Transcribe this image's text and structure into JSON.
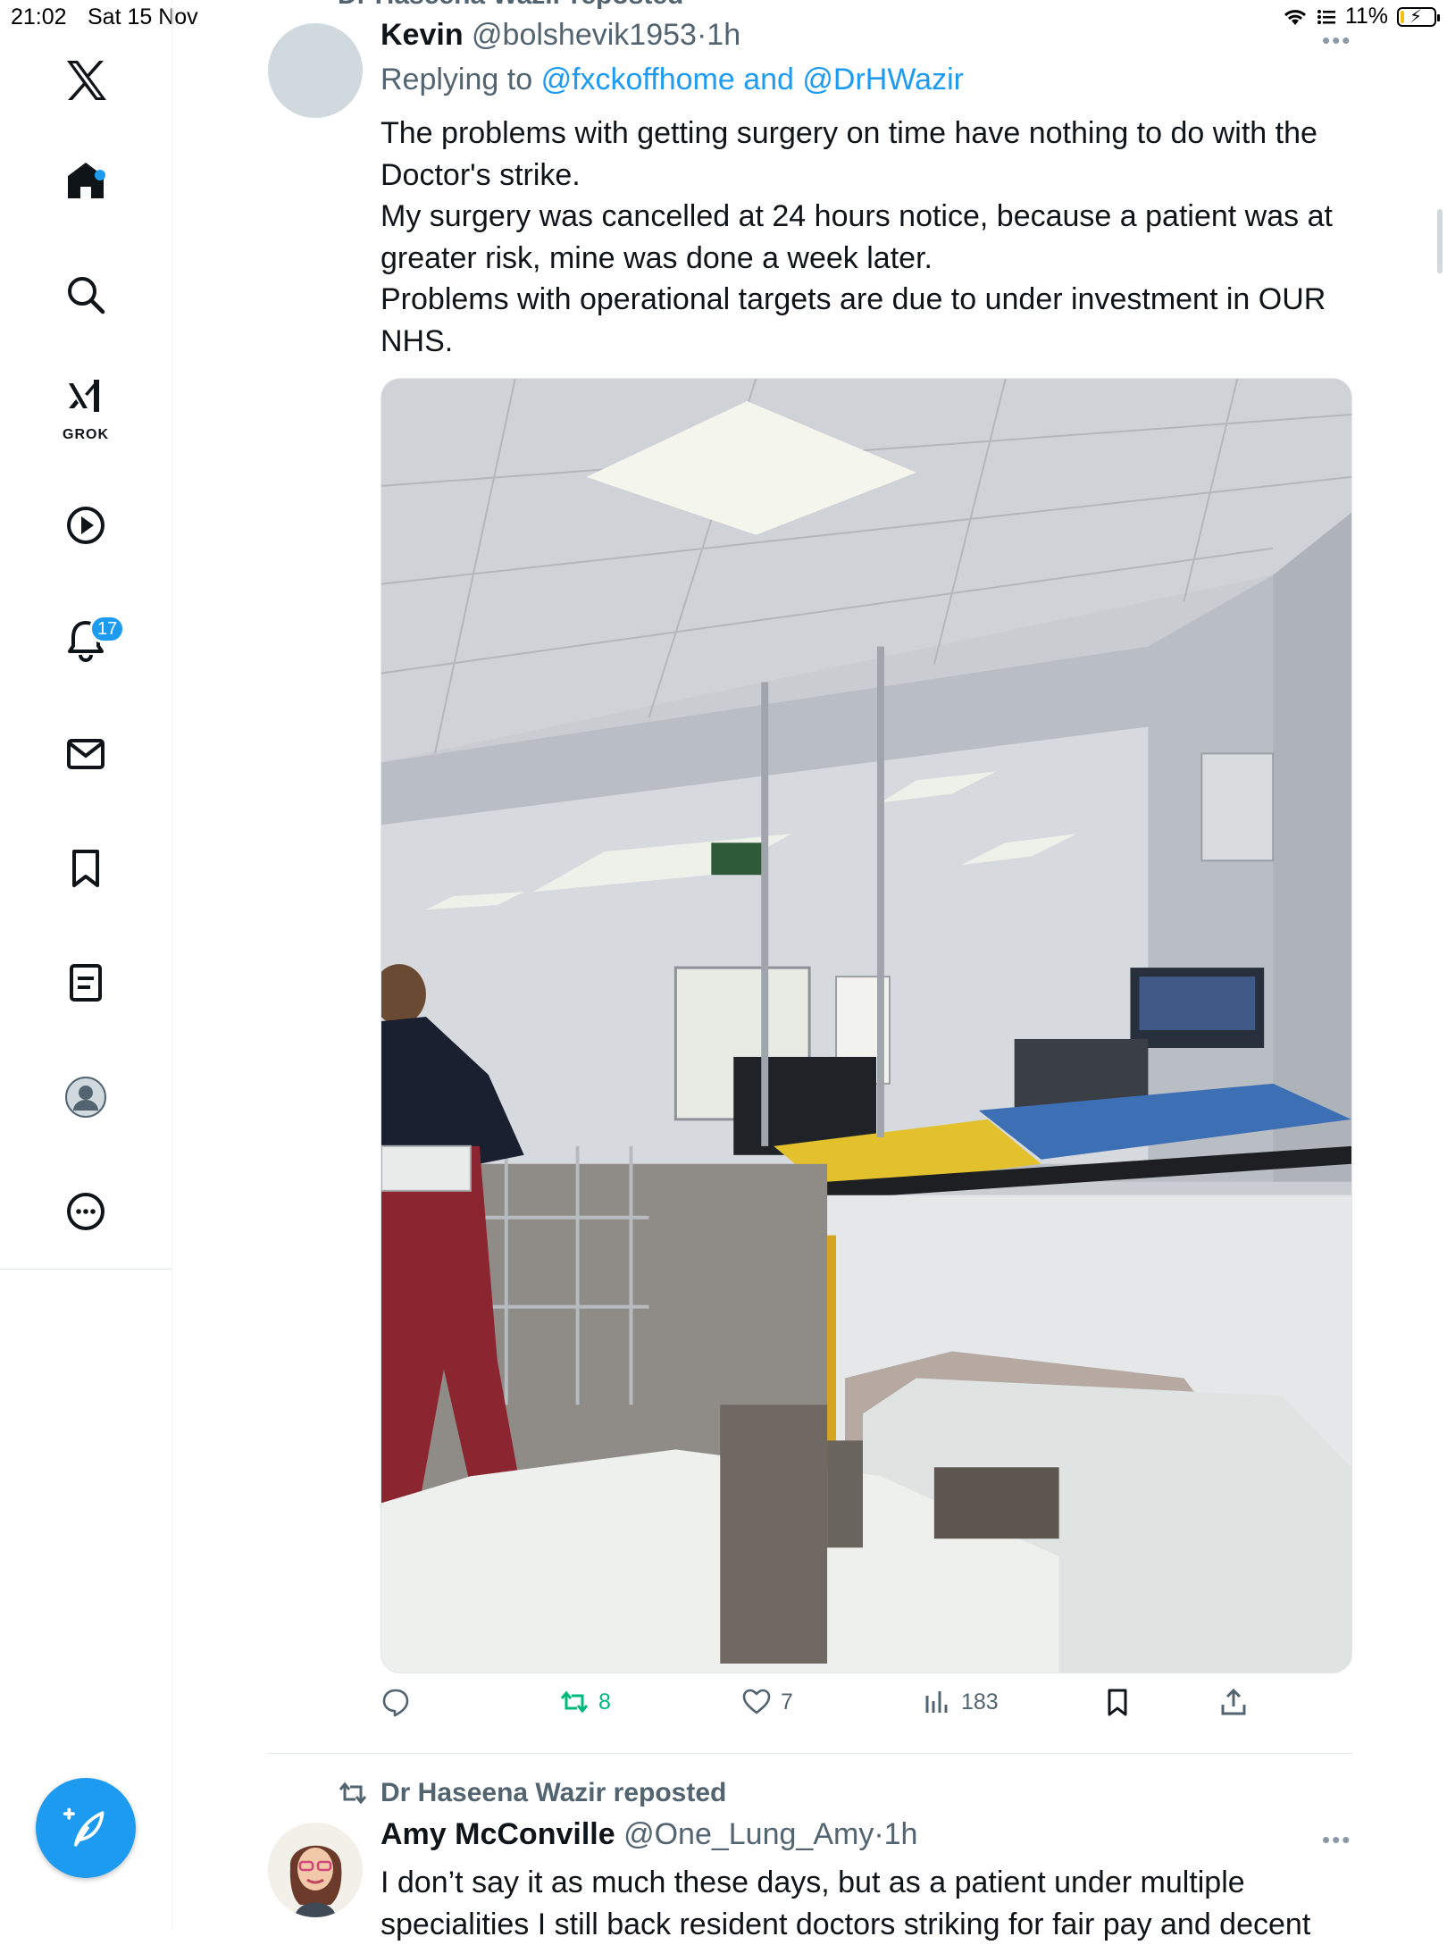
{
  "status_bar": {
    "time": "21:02",
    "date": "Sat 15 Nov",
    "battery": "11%",
    "battery_level": 0.11
  },
  "sidebar": {
    "grok_label": "GROK",
    "notifications_count": "17",
    "home_has_update": true,
    "items": [
      "x-logo",
      "home-icon",
      "search-icon",
      "grok-icon",
      "video-icon",
      "bell-icon",
      "mail-icon",
      "bookmark-icon",
      "lists-icon",
      "profile-icon",
      "more-icon"
    ]
  },
  "timeline": {
    "top_repost_text": "Dr Haseena Wazir reposted",
    "tweet1": {
      "name": "Kevin",
      "handle": "@bolshevik1953",
      "dot": "·",
      "time": "1h",
      "replying_to_prefix": "Replying to",
      "replying_to_mentions": "@fxckoffhome and @DrHWazir",
      "text_lines": [
        "The problems with getting surgery on time have nothing to do with the Doctor's strike.",
        "My surgery was cancelled at 24 hours notice, because a patient was at greater risk, mine was done a week later.",
        "Problems with operational targets are due to under investment in OUR NHS."
      ],
      "reposts": "8",
      "likes": "7",
      "views": "183"
    },
    "tweet2": {
      "repost_label": "Dr Haseena Wazir reposted",
      "name": "Amy McConville",
      "handle": "@One_Lung_Amy",
      "dot": "·",
      "time": "1h",
      "text": "I don’t say it as much these days, but as a patient under multiple specialities I still back resident doctors striking for fair pay and decent"
    }
  },
  "colors": {
    "accent": "#1d9bf0",
    "retweet_green": "#00ba7c",
    "secondary_text": "#536471"
  }
}
